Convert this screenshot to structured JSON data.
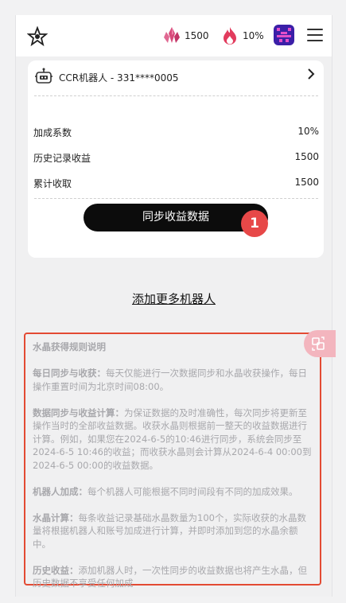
{
  "header": {
    "crystal_balance": "1500",
    "fire_rate": "10%",
    "icons": [
      "spider-logo-icon",
      "crystal-icon",
      "fire-icon",
      "avatar",
      "hamburger-menu-icon"
    ],
    "colors": {
      "crystal": "#d84a7a",
      "fire": "#e23b5d",
      "avatar_bg": "#3b1fa8"
    }
  },
  "robot_card": {
    "robot_name": "CCR机器人 - 331****0005",
    "rows": [
      {
        "label": "加成系数",
        "value": "10%"
      },
      {
        "label": "历史记录收益",
        "value": "1500"
      },
      {
        "label": "累计收取",
        "value": "1500"
      }
    ],
    "sync_button": "同步收益数据",
    "badge": "1"
  },
  "add_more_label": "添加更多机器人",
  "rules": {
    "title": "水晶获得规则说明",
    "sections": [
      {
        "heading": "每日同步与收获：",
        "text": "每天仅能进行一次数据同步和水晶收获操作，每日操作重置时间为北京时间08:00。"
      },
      {
        "heading": "数据同步与收益计算：",
        "text": "为保证数据的及时准确性，每次同步将更新至操作当时的全部收益数据。收获水晶则根据前一整天的收益数据进行计算。例如，如果您在2024-6-5的10:46进行同步，系统会同步至2024-6-5 10:46的收益；而收获水晶则会计算从2024-6-4 00:00到2024-6-5 00:00的收益数据。"
      },
      {
        "heading": "机器人加成：",
        "text": "每个机器人可能根据不同时间段有不同的加成效果。"
      },
      {
        "heading": "水晶计算：",
        "text": "每条收益记录基础水晶数量为100个，实际收获的水晶数量将根据机器人和账号加成进行计算，并即时添加到您的水晶余额中。"
      },
      {
        "heading": "历史收益：",
        "text": "添加机器人时，一次性同步的收益数据也将产生水晶，但历史数据不享受任何加成"
      }
    ],
    "accent_color": "#e34a33"
  },
  "floating_button_icon": "translate-icon"
}
